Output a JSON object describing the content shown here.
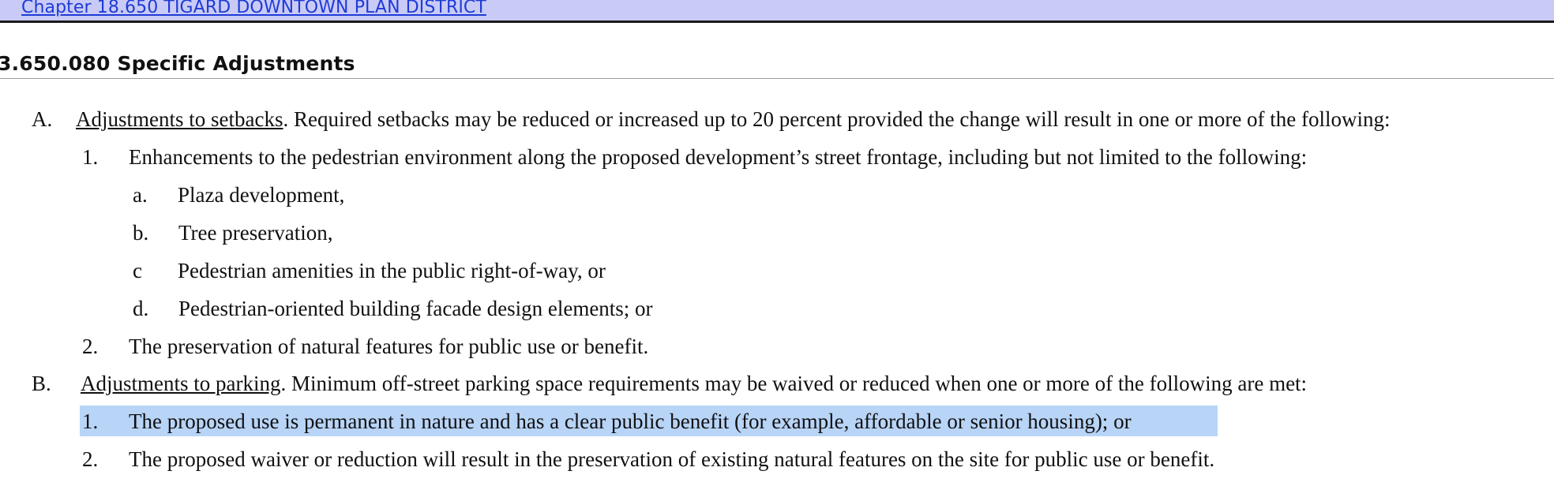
{
  "header": {
    "chapter_link": "Chapter 18.650 TIGARD DOWNTOWN PLAN DISTRICT"
  },
  "section": {
    "heading": "3.650.080 Specific Adjustments"
  },
  "items": {
    "a": {
      "marker": "A.",
      "link": "Adjustments to setbacks",
      "text": ". Required setbacks may be reduced or increased up to 20 percent provided the change will result in one or more of the following:"
    },
    "a1": {
      "marker": "1.",
      "text": "Enhancements to the pedestrian environment along the proposed development’s street frontage, including but not limited to the following:"
    },
    "a1a": {
      "marker": "a.",
      "text": "Plaza development,"
    },
    "a1b": {
      "marker": "b.",
      "text": "Tree preservation,"
    },
    "a1c": {
      "marker": "c",
      "text": "Pedestrian amenities in the public right-of-way, or"
    },
    "a1d": {
      "marker": "d.",
      "text": "Pedestrian-oriented building facade design elements; or"
    },
    "a2": {
      "marker": "2.",
      "text": "The preservation of natural features for public use or benefit."
    },
    "b": {
      "marker": "B.",
      "link": "Adjustments to parking",
      "text": ". Minimum off-street parking space requirements may be waived or reduced when one or more of the following are met:"
    },
    "b1": {
      "marker": "1.",
      "text": "The proposed use is permanent in nature and has a clear public benefit (for example, affordable or senior housing); or"
    },
    "b2": {
      "marker": "2.",
      "text": "The proposed waiver or reduction will result in the preservation of existing natural features on the site for public use or benefit."
    }
  },
  "colors": {
    "header_bar": "#c9cbf6",
    "link": "#1f3bd6",
    "selection_highlight": "#b8d4f7"
  }
}
